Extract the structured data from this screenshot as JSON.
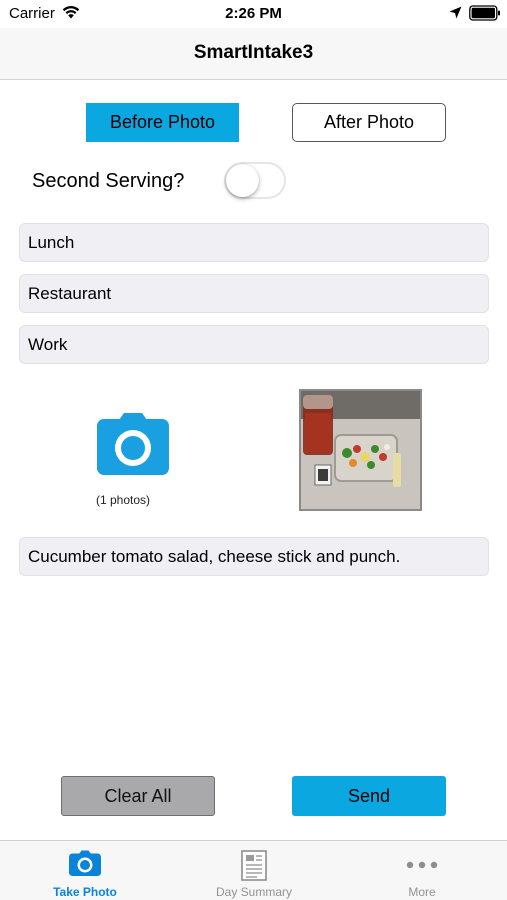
{
  "status_bar": {
    "carrier": "Carrier",
    "time": "2:26 PM",
    "icons": [
      "wifi-icon",
      "location-arrow-icon",
      "battery-icon"
    ]
  },
  "nav": {
    "title": "SmartIntake3"
  },
  "photo_mode": {
    "before_label": "Before Photo",
    "after_label": "After Photo",
    "selected": "Before Photo"
  },
  "second_serving": {
    "label": "Second Serving?",
    "on": false
  },
  "fields": {
    "meal": "Lunch",
    "location": "Restaurant",
    "context": "Work",
    "description": "Cucumber tomato salad, cheese stick and punch."
  },
  "photos": {
    "count_label": "(1 photos)",
    "icon": "camera-icon"
  },
  "actions": {
    "clear_label": "Clear All",
    "send_label": "Send"
  },
  "tabs": [
    {
      "label": "Take Photo",
      "icon": "camera-icon",
      "active": true
    },
    {
      "label": "Day Summary",
      "icon": "document-icon",
      "active": false
    },
    {
      "label": "More",
      "icon": "more-dots-icon",
      "active": false
    }
  ],
  "colors": {
    "accent": "#0ba7e0",
    "tab_active": "#0a84d9",
    "clear_button": "#a9a9ab",
    "field_background": "#efeff4"
  }
}
